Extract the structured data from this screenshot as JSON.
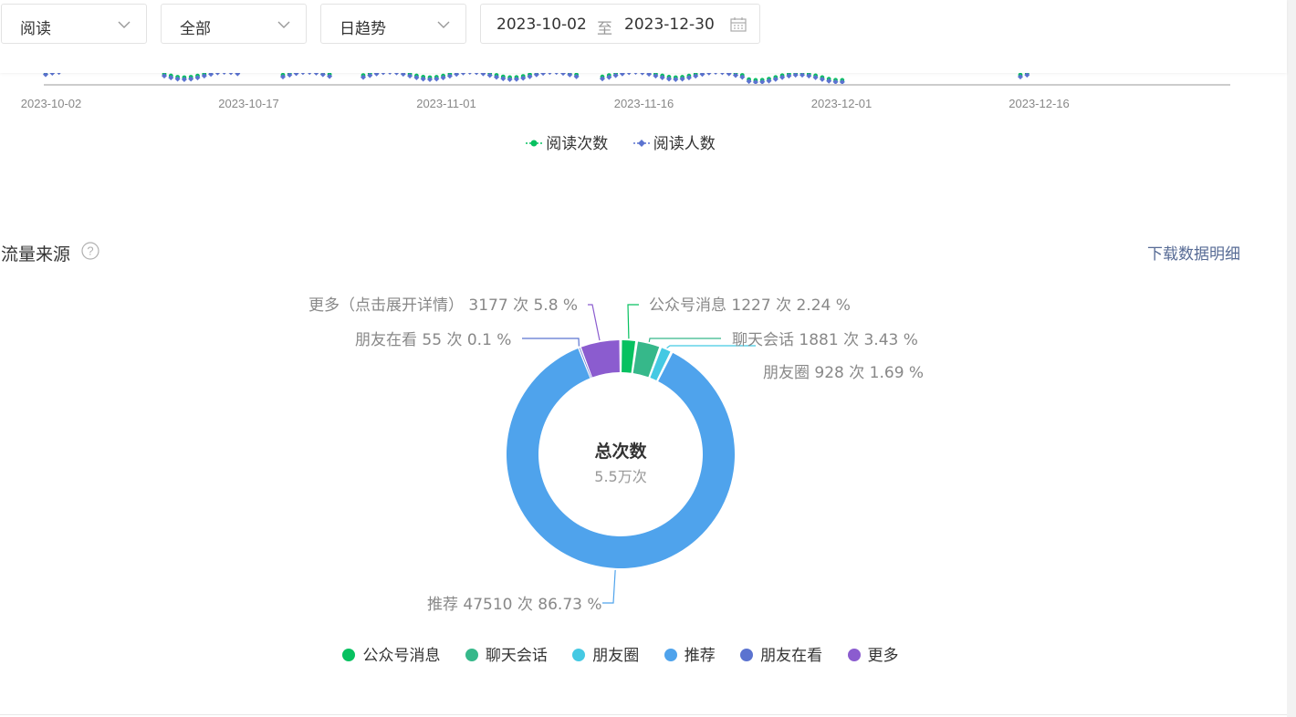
{
  "filters": {
    "metric": "阅读",
    "scope": "全部",
    "granularity": "日趋势",
    "date_start": "2023-10-02",
    "date_to": "至",
    "date_end": "2023-12-30"
  },
  "trend_chart": {
    "x_ticks": [
      "2023-10-02",
      "2023-10-17",
      "2023-11-01",
      "2023-11-16",
      "2023-12-01",
      "2023-12-16"
    ],
    "legend": [
      {
        "name": "阅读次数",
        "color": "#07c160"
      },
      {
        "name": "阅读人数",
        "color": "#5b73d0"
      }
    ]
  },
  "traffic": {
    "title": "流量来源",
    "download_label": "下载数据明细",
    "center_title": "总次数",
    "center_value": "5.5万次"
  },
  "chart_data": {
    "type": "pie",
    "title": "",
    "total_label": "总次数",
    "total_value": "5.5万次",
    "slices": [
      {
        "name": "公众号消息",
        "value": 1227,
        "percent": 2.24,
        "color": "#07c160",
        "label": "公众号消息 1227 次 2.24 %"
      },
      {
        "name": "聊天会话",
        "value": 1881,
        "percent": 3.43,
        "color": "#36b88a",
        "label": "聊天会话 1881 次 3.43 %"
      },
      {
        "name": "朋友圈",
        "value": 928,
        "percent": 1.69,
        "color": "#45c9e3",
        "label": "朋友圈 928 次 1.69 %"
      },
      {
        "name": "推荐",
        "value": 47510,
        "percent": 86.73,
        "color": "#4fa3ec",
        "label": "推荐 47510 次 86.73 %"
      },
      {
        "name": "朋友在看",
        "value": 55,
        "percent": 0.1,
        "color": "#5b73d0",
        "label": "朋友在看 55 次 0.1 %"
      },
      {
        "name": "更多",
        "value": 3177,
        "percent": 5.8,
        "color": "#8b5ccf",
        "label": "更多（点击展开详情） 3177 次 5.8 %"
      }
    ],
    "legend_placement": "bottom"
  }
}
